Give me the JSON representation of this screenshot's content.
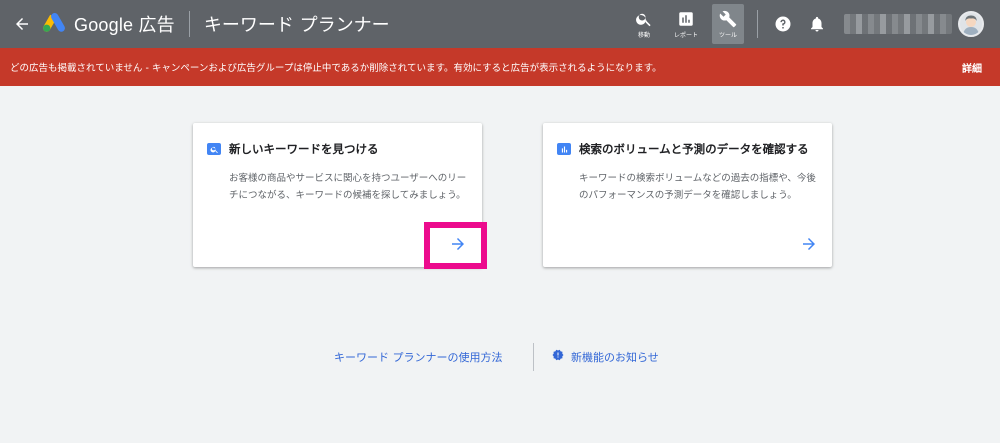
{
  "header": {
    "back_icon": "arrow-back-icon",
    "brand": "Google 広告",
    "page_title": "キーワード プランナー",
    "tools": [
      {
        "icon": "search-icon",
        "label": "移動"
      },
      {
        "icon": "bar-chart-icon",
        "label": "レポート"
      },
      {
        "icon": "wrench-icon",
        "label": "ツール"
      }
    ],
    "help_icon": "help-icon",
    "notifications_icon": "bell-icon"
  },
  "banner": {
    "text": "どの広告も掲載されていません - キャンペーンおよび広告グループは停止中であるか削除されています。有効にすると広告が表示されるようになります。",
    "link": "詳細",
    "color": "#c53929"
  },
  "cards": [
    {
      "icon": "search-icon",
      "title": "新しいキーワードを見つける",
      "description": "お客様の商品やサービスに関心を持つユーザーへのリーチにつながる、キーワードの候補を探してみましょう。",
      "arrow_icon": "arrow-forward-icon"
    },
    {
      "icon": "bar-chart-icon",
      "title": "検索のボリュームと予測のデータを確認する",
      "description": "キーワードの検索ボリュームなどの過去の指標や、今後のパフォーマンスの予測データを確認しましょう。",
      "arrow_icon": "arrow-forward-icon"
    }
  ],
  "footer": {
    "howto_link": "キーワード プランナーの使用方法",
    "news_link": "新機能のお知らせ"
  },
  "colors": {
    "topbar": "#5f6368",
    "accent": "#4285f4",
    "link": "#3367d6",
    "highlight": "#ec0b8d"
  }
}
